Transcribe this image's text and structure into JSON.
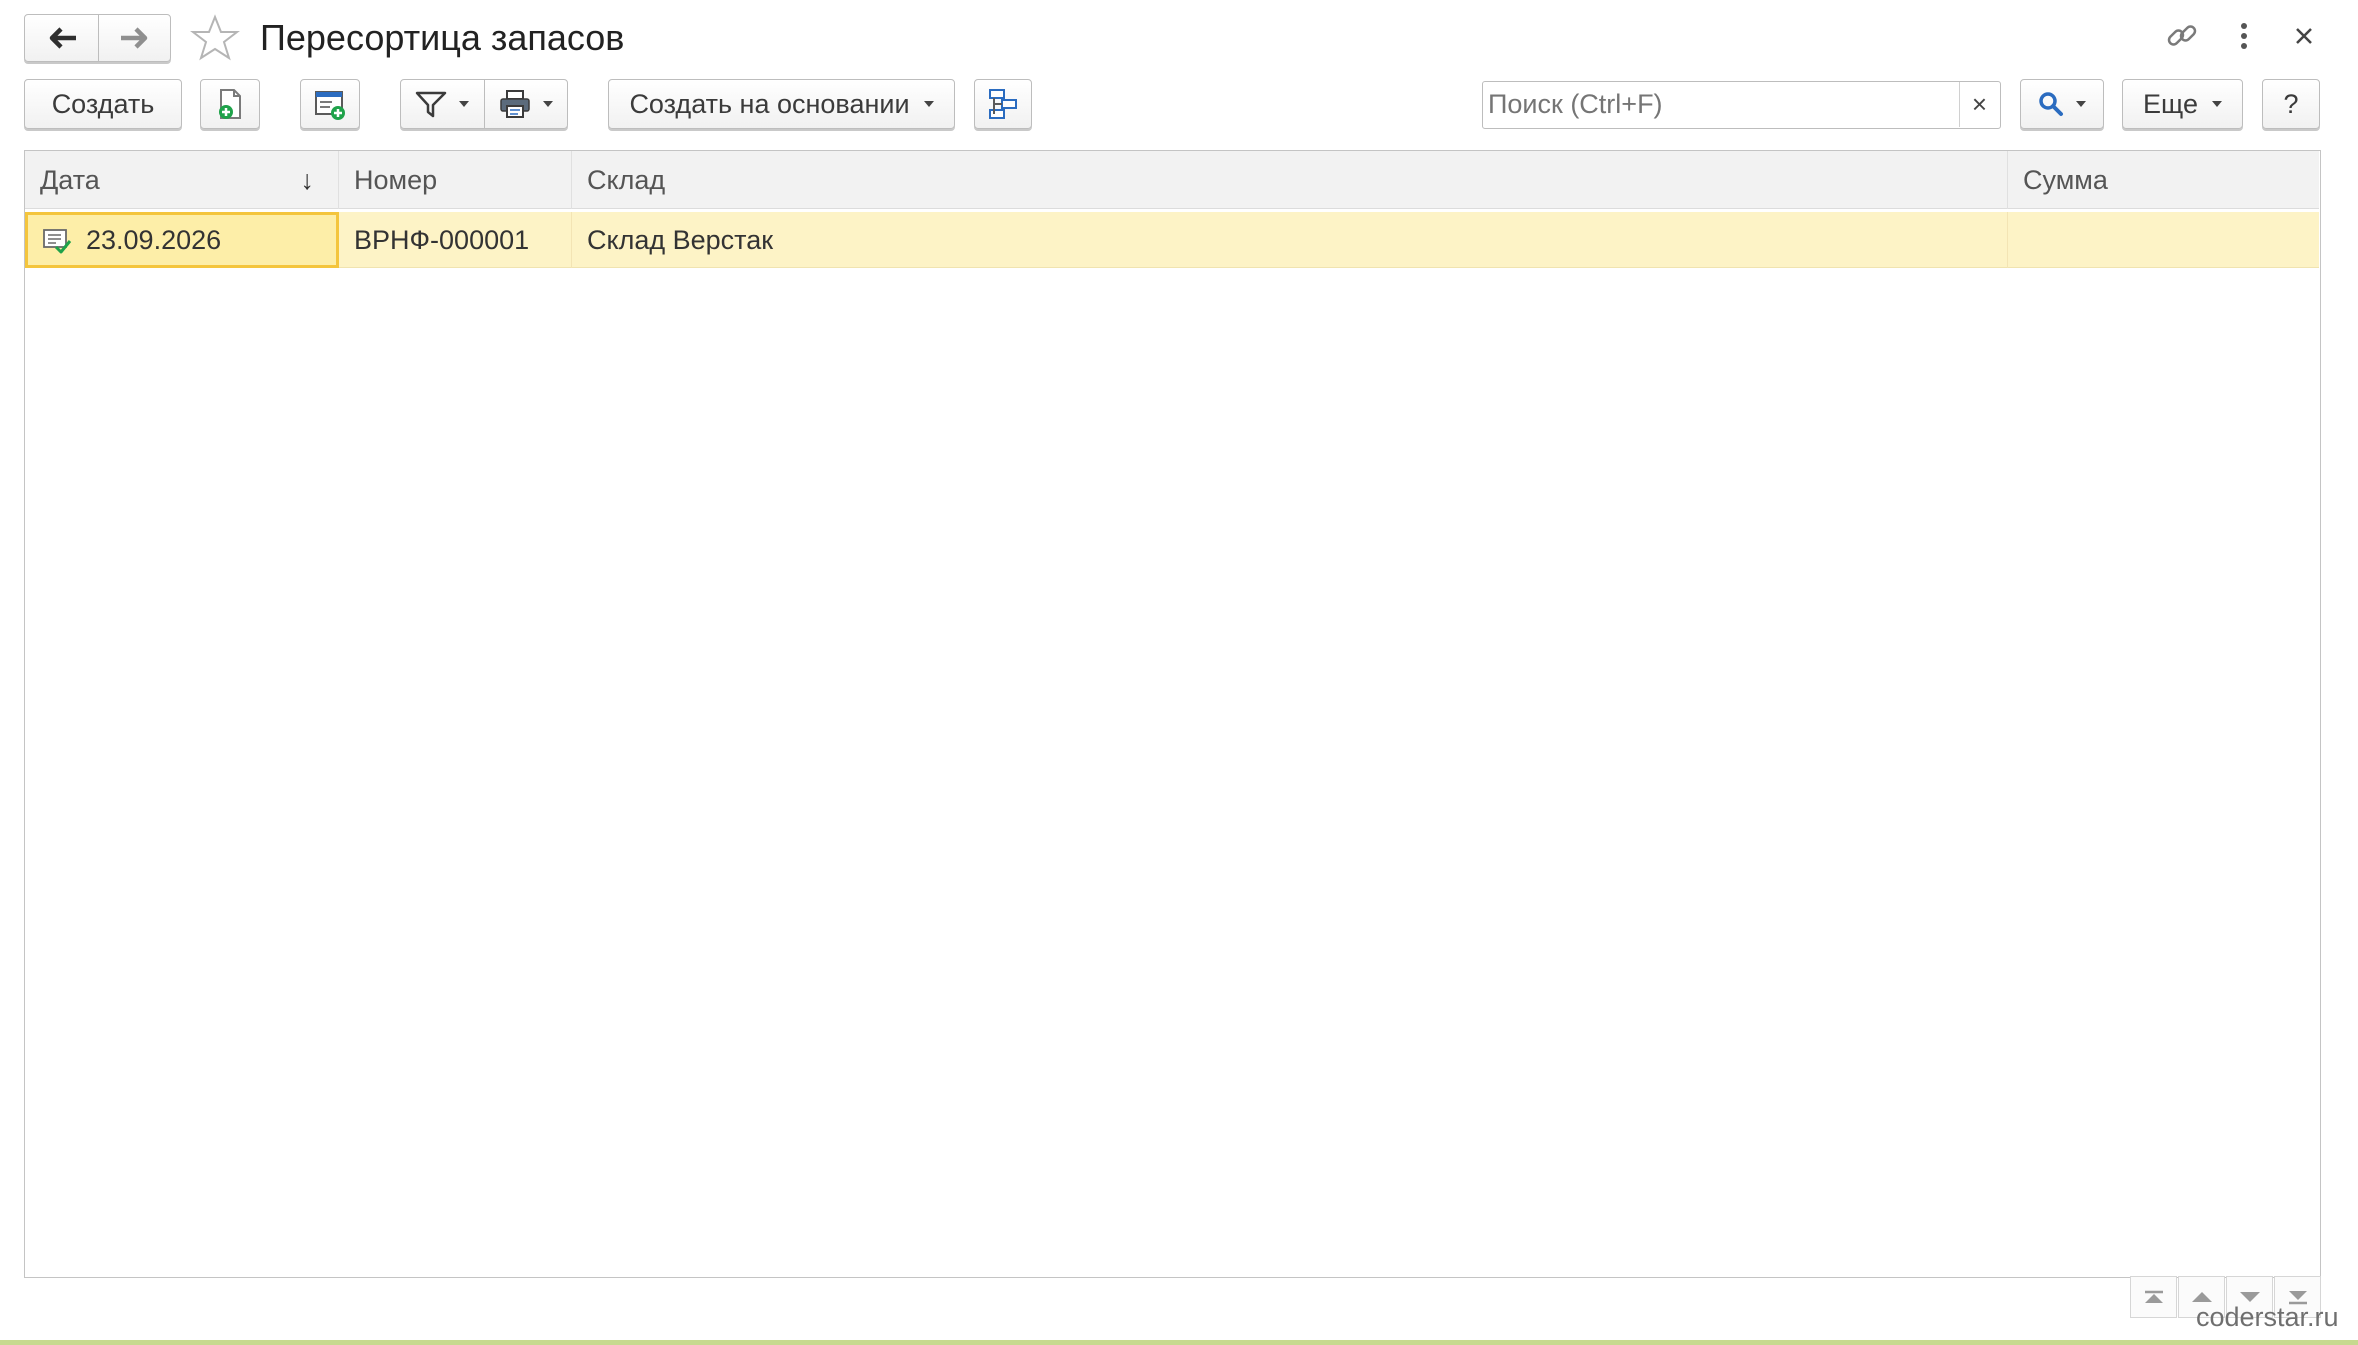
{
  "window": {
    "title": "Пересортица запасов",
    "icons": [
      "back-arrow-icon",
      "forward-arrow-icon",
      "favorite-star-icon",
      "link-icon",
      "more-vertical-icon",
      "close-icon"
    ]
  },
  "toolbar": {
    "create_label": "Создать",
    "create_based_on_label": "Создать на основании",
    "search_placeholder": "Поиск (Ctrl+F)",
    "search_clear": "×",
    "more_label": "Еще",
    "help_label": "?",
    "icons": [
      "copy-add-icon",
      "add-from-template-icon",
      "filter-icon",
      "print-icon",
      "structure-icon",
      "search-icon"
    ]
  },
  "table": {
    "columns": [
      {
        "label": "Дата",
        "sort": "↓"
      },
      {
        "label": "Номер"
      },
      {
        "label": "Склад"
      },
      {
        "label": "Сумма"
      }
    ],
    "rows": [
      {
        "date": "23.09.2026",
        "number": "ВРНФ-000001",
        "warehouse": "Склад Верстак",
        "sum": "",
        "status": "posted-document-icon"
      }
    ]
  },
  "footer": {
    "nav_icons": [
      "scroll-to-first-icon",
      "scroll-up-icon",
      "scroll-down-icon",
      "scroll-to-last-icon"
    ],
    "watermark": "coderstar.ru"
  },
  "colors": {
    "selected_row": "#fdf3c6",
    "selected_cell_border": "#f4c53d",
    "header_bg": "#f2f2f2",
    "accent_blue": "#2b6cc0",
    "accent_green": "#1fa24a"
  }
}
